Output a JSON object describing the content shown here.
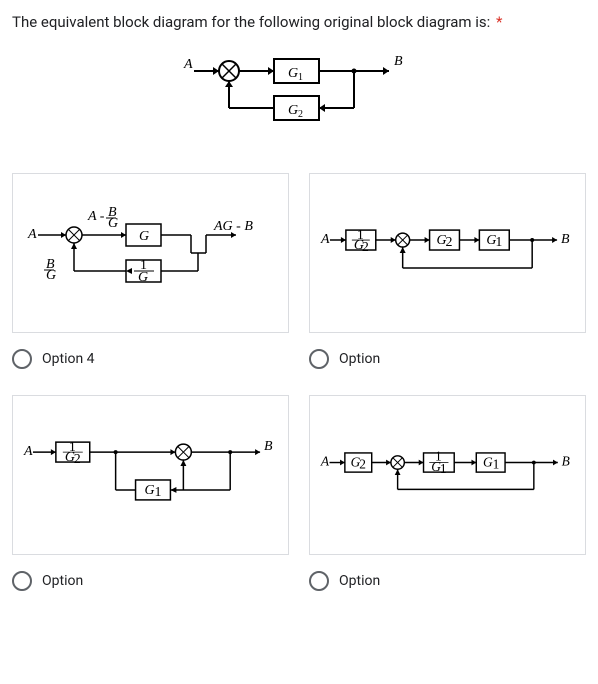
{
  "question": {
    "text": "The equivalent block diagram for the following original block diagram is:",
    "required": "*"
  },
  "main_diagram": {
    "input_label": "A",
    "output_label": "B",
    "block1": "G₁",
    "block2": "G₂"
  },
  "options": [
    {
      "label": "Option 4",
      "diagram": {
        "type": "opt4",
        "input": "A",
        "top_label": "A - B/G",
        "feedback_label": "B/G",
        "block_g": "G",
        "block_inv": "1/G",
        "output": "AG - B"
      }
    },
    {
      "label": "Option",
      "diagram": {
        "type": "opt_series",
        "input": "A",
        "block1": "1/G₂",
        "block2": "G₂",
        "block3": "G₁",
        "output": "B"
      }
    },
    {
      "label": "Option",
      "diagram": {
        "type": "opt_feedback",
        "input": "A",
        "block1": "1/G₂",
        "feedback_block": "G₁",
        "output": "B"
      }
    },
    {
      "label": "Option",
      "diagram": {
        "type": "opt_forward",
        "input": "A",
        "block1": "G₂",
        "block2": "1/G₁",
        "block3": "G₁",
        "output": "B"
      }
    }
  ]
}
